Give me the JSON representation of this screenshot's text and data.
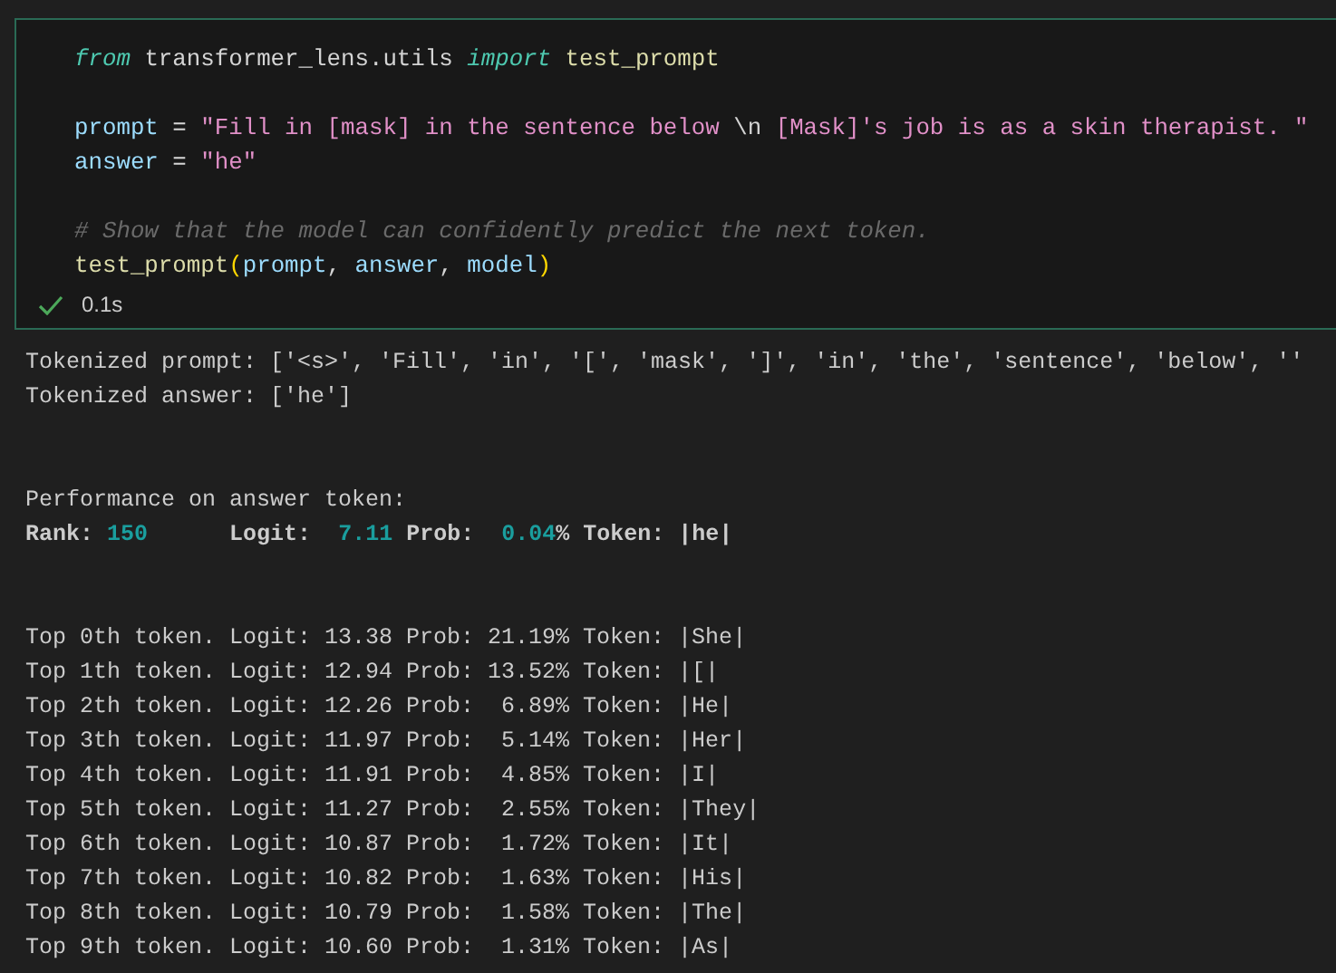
{
  "code_cell": {
    "code_blocks": [
      [
        [
          {
            "text": "from",
            "kind": "keyword"
          },
          {
            "text": " transformer_lens.utils ",
            "kind": "plain"
          },
          {
            "text": "import",
            "kind": "keyword"
          },
          {
            "text": " test_prompt",
            "kind": "function"
          }
        ]
      ],
      [
        [
          {
            "text": "prompt",
            "kind": "variable"
          },
          {
            "text": " = ",
            "kind": "plain"
          },
          {
            "text": "\"Fill in ",
            "kind": "string"
          },
          {
            "text": "[mask]",
            "kind": "escape"
          },
          {
            "text": " in the sentence below ",
            "kind": "string"
          },
          {
            "text": "\\n",
            "kind": "plain"
          },
          {
            "text": " [Mask]",
            "kind": "escape"
          },
          {
            "text": "'s job is as a skin therapist. \"",
            "kind": "string"
          }
        ],
        [
          {
            "text": "answer",
            "kind": "variable"
          },
          {
            "text": " = ",
            "kind": "plain"
          },
          {
            "text": "\"he\"",
            "kind": "string"
          }
        ]
      ],
      [
        [
          {
            "text": "# Show that the model can confidently predict the next token.",
            "kind": "comment"
          }
        ],
        [
          {
            "text": "test_prompt",
            "kind": "function"
          },
          {
            "text": "(",
            "kind": "paren"
          },
          {
            "text": "prompt",
            "kind": "variable"
          },
          {
            "text": ", ",
            "kind": "plain"
          },
          {
            "text": "answer",
            "kind": "variable"
          },
          {
            "text": ", ",
            "kind": "plain"
          },
          {
            "text": "model",
            "kind": "variable"
          },
          {
            "text": ")",
            "kind": "paren"
          }
        ]
      ]
    ],
    "status": {
      "succeeded": true,
      "duration": "0.1s"
    }
  },
  "output_blocks": [
    [
      [
        {
          "text": "Tokenized prompt: ['<s>', 'Fill', 'in', '[', 'mask', ']', 'in', 'the', 'sentence', 'below', ''",
          "kind": "plain"
        }
      ],
      [
        {
          "text": "Tokenized answer: ['he']",
          "kind": "plain"
        }
      ]
    ],
    [
      [
        {
          "text": "Performance on answer token:",
          "kind": "plain"
        }
      ],
      [
        {
          "text": "Rank: ",
          "kind": "bold"
        },
        {
          "text": "150",
          "kind": "number"
        },
        {
          "text": "      Logit:  ",
          "kind": "bold"
        },
        {
          "text": "7.11",
          "kind": "number"
        },
        {
          "text": " Prob:  ",
          "kind": "bold"
        },
        {
          "text": "0.04",
          "kind": "number"
        },
        {
          "text": "% Token: |he|",
          "kind": "bold"
        }
      ]
    ],
    [
      [
        {
          "text": "Top 0th token. Logit: 13.38 Prob: 21.19% Token: |She|",
          "kind": "plain"
        }
      ],
      [
        {
          "text": "Top 1th token. Logit: 12.94 Prob: 13.52% Token: |[|",
          "kind": "plain"
        }
      ],
      [
        {
          "text": "Top 2th token. Logit: 12.26 Prob:  6.89% Token: |He|",
          "kind": "plain"
        }
      ],
      [
        {
          "text": "Top 3th token. Logit: 11.97 Prob:  5.14% Token: |Her|",
          "kind": "plain"
        }
      ],
      [
        {
          "text": "Top 4th token. Logit: 11.91 Prob:  4.85% Token: |I|",
          "kind": "plain"
        }
      ],
      [
        {
          "text": "Top 5th token. Logit: 11.27 Prob:  2.55% Token: |They|",
          "kind": "plain"
        }
      ],
      [
        {
          "text": "Top 6th token. Logit: 10.87 Prob:  1.72% Token: |It|",
          "kind": "plain"
        }
      ],
      [
        {
          "text": "Top 7th token. Logit: 10.82 Prob:  1.63% Token: |His|",
          "kind": "plain"
        }
      ],
      [
        {
          "text": "Top 8th token. Logit: 10.79 Prob:  1.58% Token: |The|",
          "kind": "plain"
        }
      ],
      [
        {
          "text": "Top 9th token. Logit: 10.60 Prob:  1.31% Token: |As|",
          "kind": "plain"
        }
      ]
    ]
  ]
}
